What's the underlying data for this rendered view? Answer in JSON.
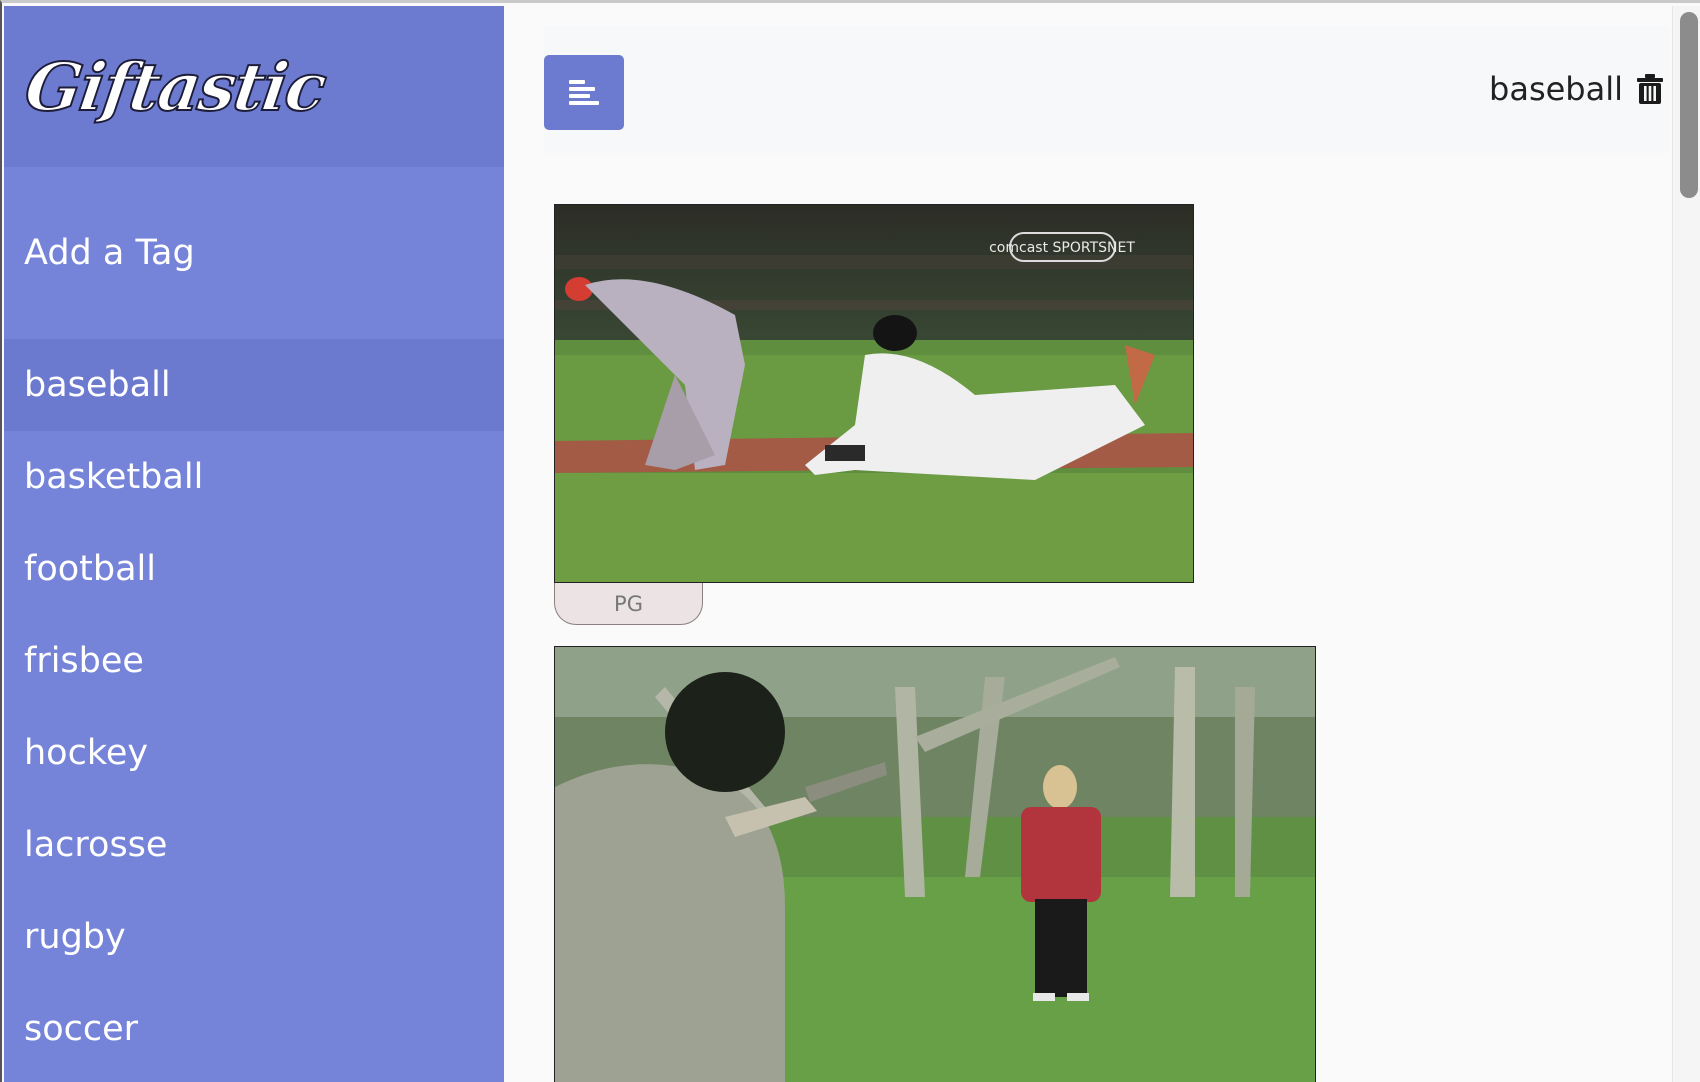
{
  "app": {
    "brand": "Giftastic"
  },
  "sidebar": {
    "add_tag_label": "Add a Tag",
    "tags": [
      {
        "label": "baseball",
        "active": true
      },
      {
        "label": "basketball",
        "active": false
      },
      {
        "label": "football",
        "active": false
      },
      {
        "label": "frisbee",
        "active": false
      },
      {
        "label": "hockey",
        "active": false
      },
      {
        "label": "lacrosse",
        "active": false
      },
      {
        "label": "rugby",
        "active": false
      },
      {
        "label": "soccer",
        "active": false
      }
    ]
  },
  "header": {
    "menu_icon": "menu-lines-icon",
    "current_tag": "baseball",
    "delete_icon": "trash-icon"
  },
  "gifs": [
    {
      "rating": "PG",
      "overlay_text": "comcast SPORTSNET"
    },
    {
      "rating": ""
    }
  ],
  "colors": {
    "sidebar": "#7583d8",
    "sidebar_header": "#6c7bcf",
    "active_tag": "#6b79ce",
    "menu_button": "#6c7bcf"
  }
}
